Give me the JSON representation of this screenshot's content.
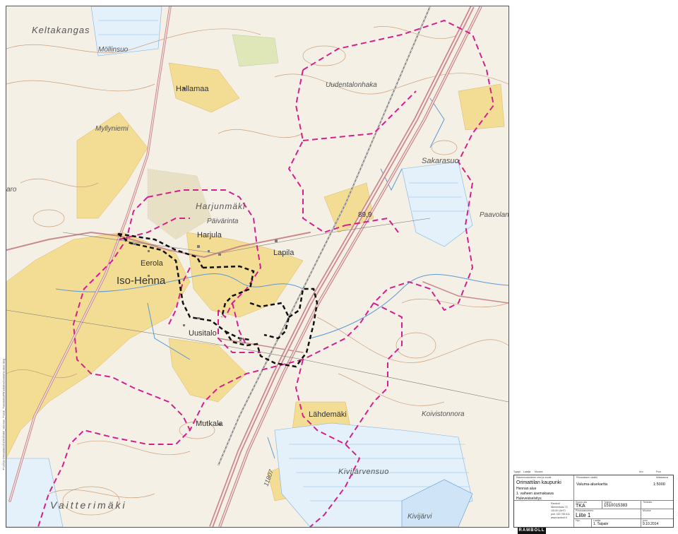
{
  "side_label": "P:\\1510-Orimattila\\1510015383_Hennan_T1a\\K_Tulostettu\\Piirustukset\\valuma-alue.dwg",
  "map": {
    "place_names": {
      "keltakangas": "Keltakangas",
      "mollinsuo": "Möllinsuo",
      "hallamaa": "Hallamaa",
      "myllyniemi": "Myllyniemi",
      "uudentalonhaka": "Uudentalonhaka",
      "sakarasuo": "Sakarasuo",
      "aro": "aro",
      "harjunmaki": "Harjunmäki",
      "paivarinta": "Päivärinta",
      "harjula": "Harjula",
      "paavolans": "Paavolans",
      "lapila": "Lapila",
      "elev_899": "89,9",
      "eerola": "Eerola",
      "iso_henna": "Iso-Henna",
      "uusitalo": "Uusitalo",
      "lahdemaki": "Lähdemäki",
      "koivistonnora": "Koivistonnora",
      "mutkala": "Mutkala",
      "kivijarvensuo": "Kivijärvensuo",
      "road_11807": "11807",
      "vaitterimaki": "Vaitterimäki",
      "kivijarvi": "Kivijärvi"
    },
    "colors": {
      "catchment_boundary": "#d4208c",
      "plan_area_boundary": "#111111",
      "road": "#c98a8a",
      "field": "#f2d98a",
      "water": "#7ab4e8",
      "contour": "#c9a07a"
    }
  },
  "revision_row": {
    "muut": "Muutos",
    "pvm": "Pvm",
    "laatija": "Laatija",
    "muutos": "Muutos",
    "nro": "Nro",
    "tyyppi": "Tyyppi"
  },
  "title_block": {
    "client_caption": "Rakennuskohteen nimi ja osoite",
    "client_name": "Orimattilan kaupunki",
    "line2": "Hennan alue",
    "line3": "1. vaiheen asemakaava",
    "line4": "Hulevesiselvitys",
    "drawing_caption": "Piirustuksen sisältö",
    "drawing_title": "Valuma-aluekartta",
    "scale_caption": "Mittakaava",
    "scale": "1:5000",
    "company": "RAMBOLL",
    "company_info_1": "Ramboll",
    "company_info_2": "Niemenkatu 73",
    "company_info_3": "15140 LAHTI",
    "company_info_4": "puh. 020 755 611",
    "company_info_5": "www.ramboll.fi",
    "suunn_caption": "Suunn.ala",
    "suunn_value": "TKA",
    "tyonro_caption": "Työnro",
    "tyonro_value": "1510015383",
    "piirnro_caption": "Piirustusnumero",
    "piirnro_value": "Liite 1",
    "tiedosto_caption": "Tiedosto",
    "muutos_caption": "Muutos",
    "pvm_caption": "pvm",
    "pvm_value": "9.10.2014",
    "laatija_caption": "Laatija",
    "laatija_value": "1. Taipale",
    "hyv_caption": "Hyv."
  }
}
